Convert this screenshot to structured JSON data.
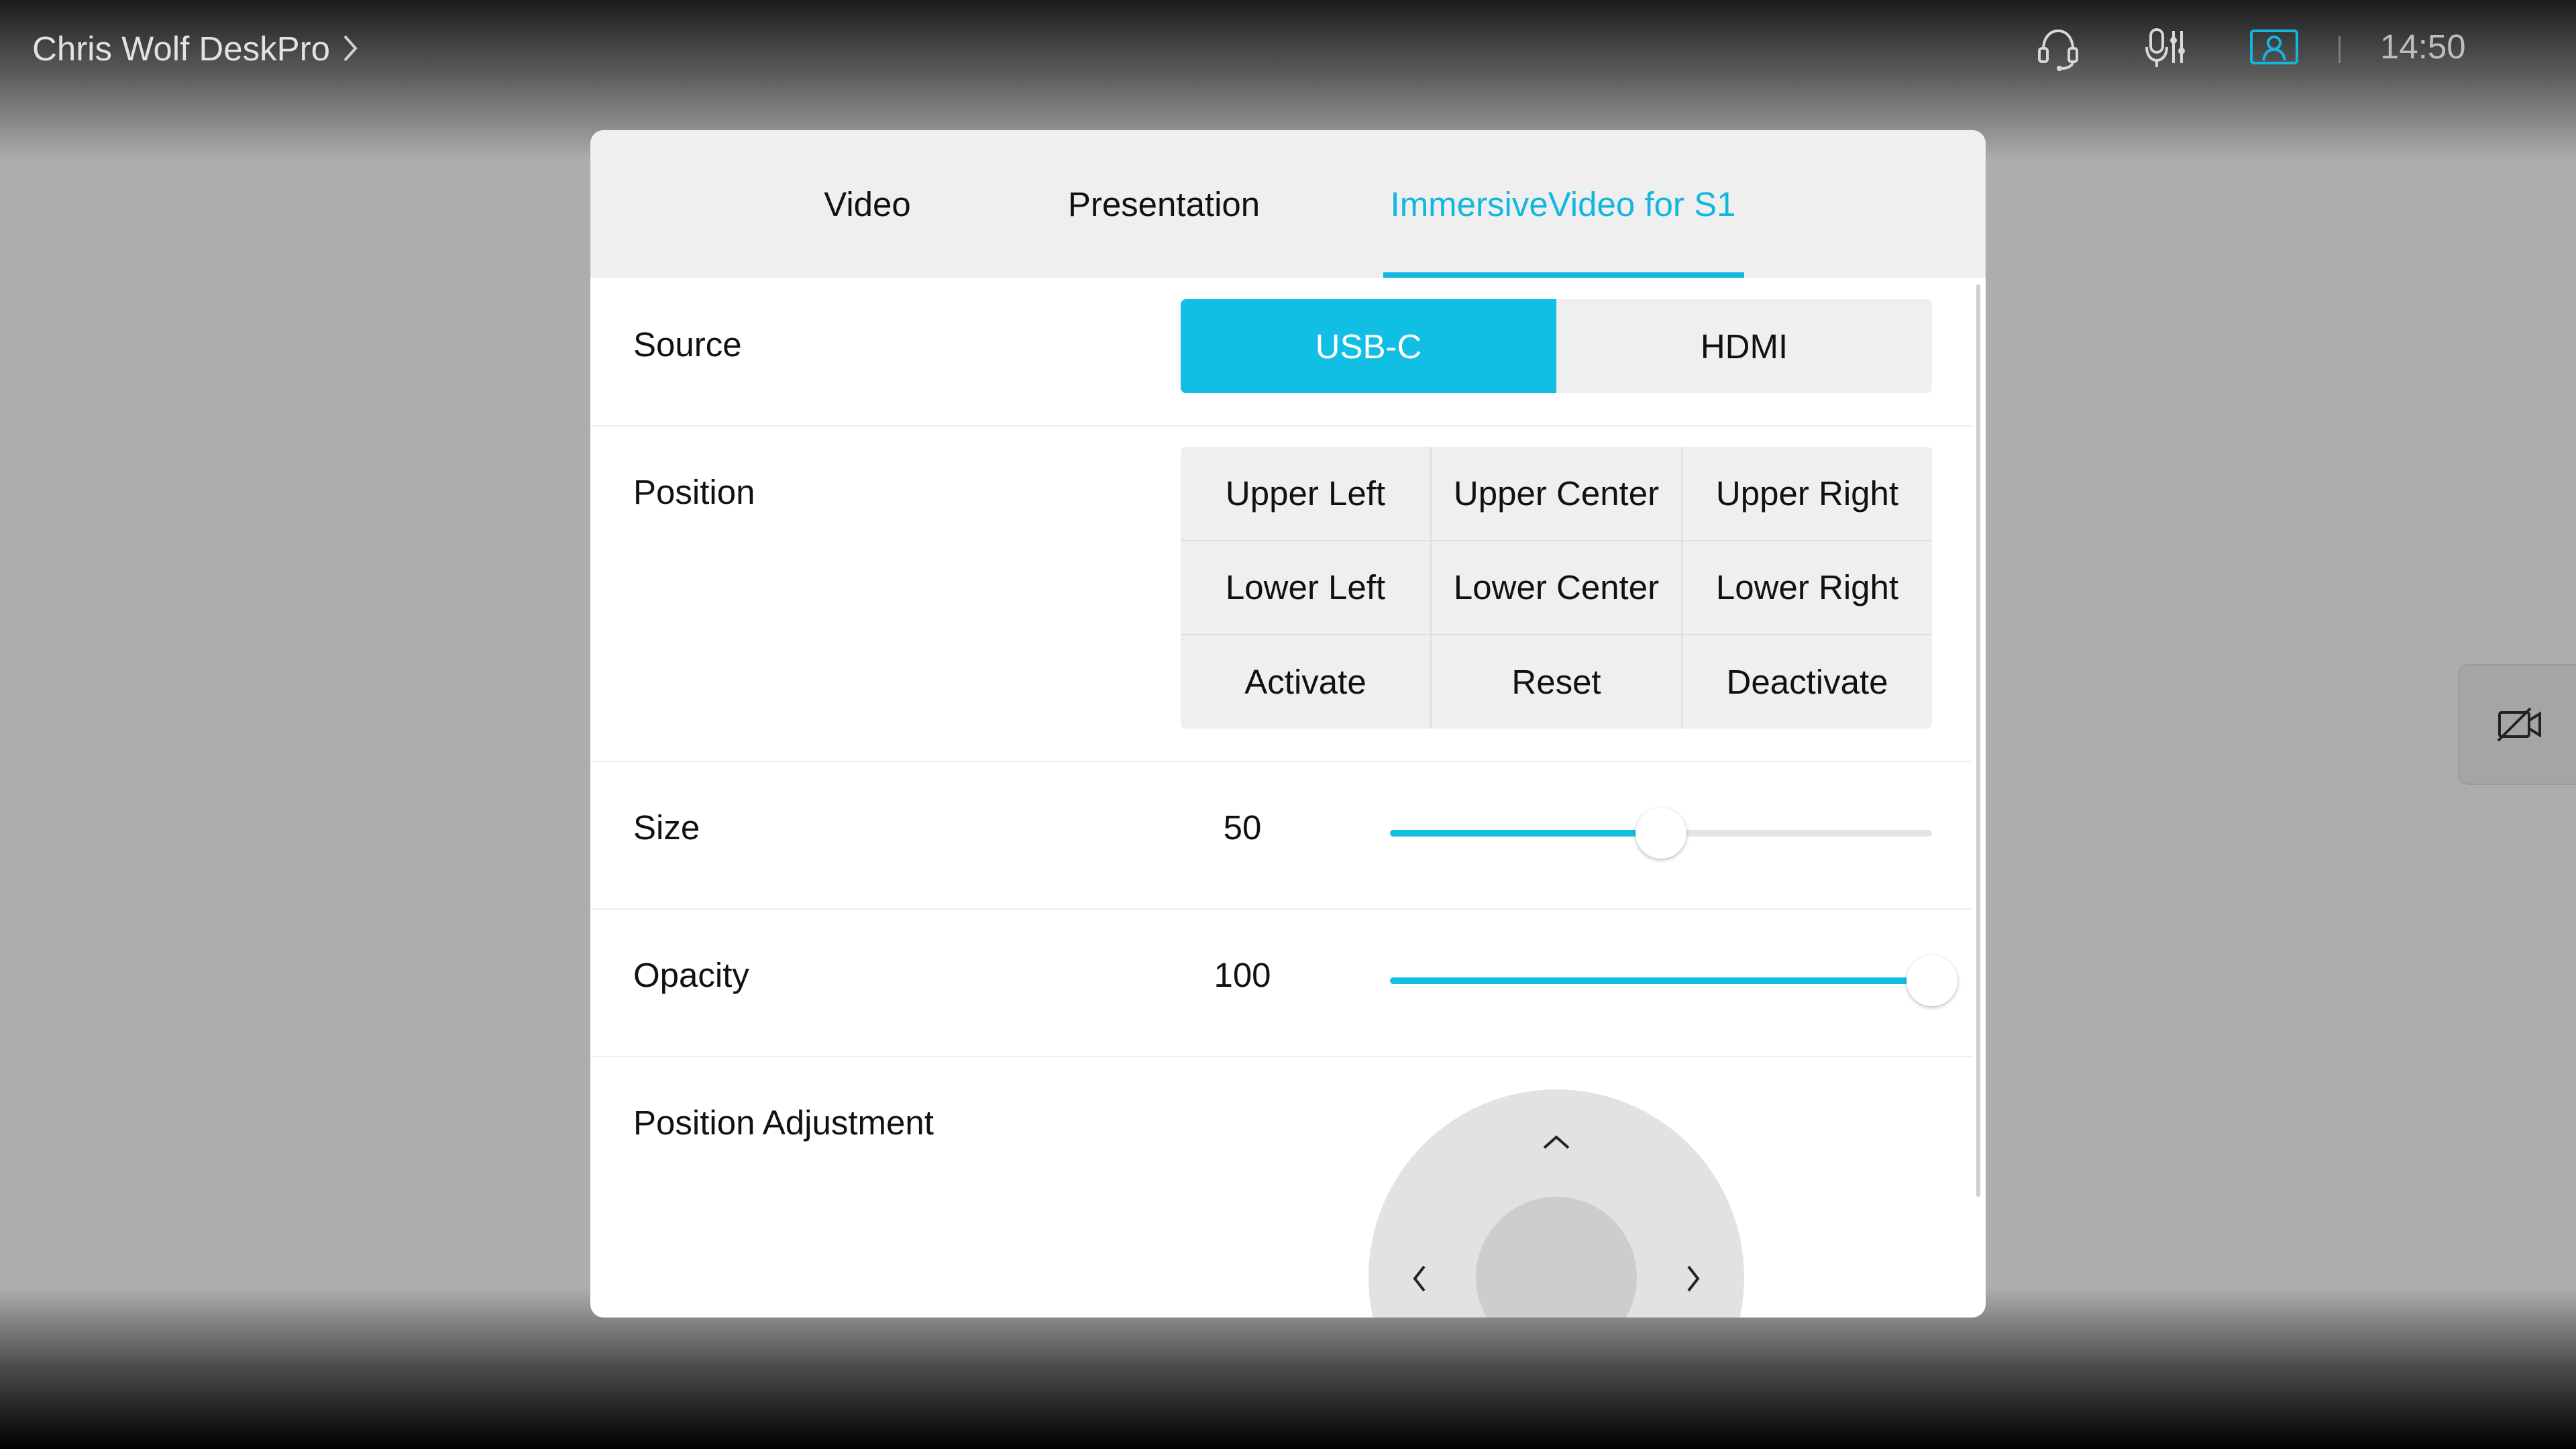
{
  "topbar": {
    "device_name": "Chris Wolf DeskPro",
    "time": "14:50",
    "icons": [
      "headset-icon",
      "mic-settings-icon",
      "selfview-icon"
    ],
    "active_icon_color": "#12b7de"
  },
  "panel": {
    "tabs": [
      {
        "label": "Video",
        "active": false
      },
      {
        "label": "Presentation",
        "active": false
      },
      {
        "label": "ImmersiveVideo for S1",
        "active": true
      }
    ],
    "source": {
      "label": "Source",
      "options": [
        "USB-C",
        "HDMI"
      ],
      "selected": "USB-C"
    },
    "position": {
      "label": "Position",
      "buttons": [
        [
          "Upper Left",
          "Upper Center",
          "Upper Right"
        ],
        [
          "Lower Left",
          "Lower Center",
          "Lower Right"
        ],
        [
          "Activate",
          "Reset",
          "Deactivate"
        ]
      ]
    },
    "size": {
      "label": "Size",
      "value": "50",
      "fraction": 0.5
    },
    "opacity": {
      "label": "Opacity",
      "value": "100",
      "fraction": 1.0
    },
    "position_adjustment": {
      "label": "Position Adjustment",
      "controls": [
        "up-arrow-icon",
        "left-arrow-icon",
        "right-arrow-icon"
      ]
    }
  },
  "side_button": {
    "icon": "camera-off-icon"
  },
  "colors": {
    "accent": "#12bfe4",
    "panel": "#ffffff",
    "tab_bar": "#efefef"
  }
}
